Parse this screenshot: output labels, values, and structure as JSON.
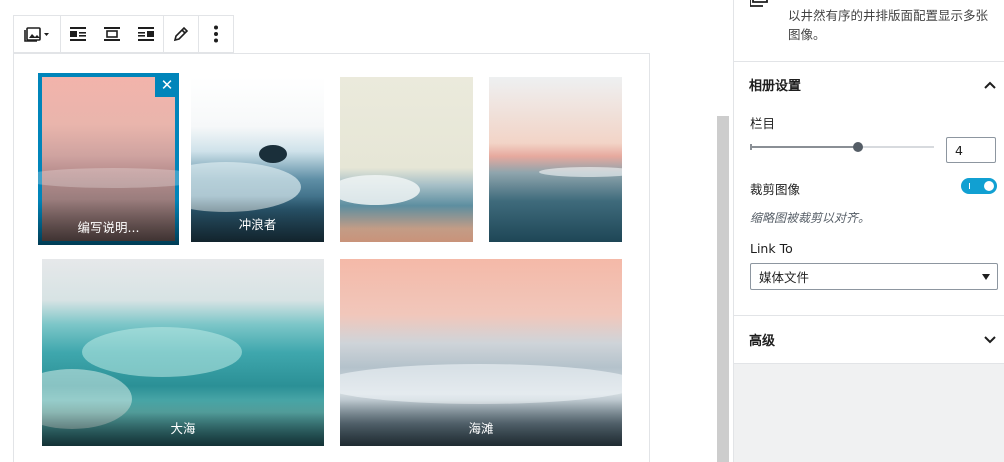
{
  "toolbar": {
    "buttons": [
      {
        "icon": "gallery-icon"
      },
      {
        "icon": "align-left-icon"
      },
      {
        "icon": "align-center-icon"
      },
      {
        "icon": "align-right-icon"
      },
      {
        "icon": "edit-pencil-icon"
      },
      {
        "icon": "more-vertical-icon"
      }
    ]
  },
  "gallery": {
    "images": [
      {
        "caption": "编写说明...",
        "selected": true
      },
      {
        "caption": "冲浪者",
        "selected": false
      },
      {
        "caption": "",
        "selected": false
      },
      {
        "caption": "",
        "selected": false
      },
      {
        "caption": "大海",
        "selected": false
      },
      {
        "caption": "海滩",
        "selected": false
      }
    ],
    "remove_symbol": "✕"
  },
  "sidebar": {
    "description": "以井然有序的井排版面配置显示多张图像。",
    "gallery_settings": {
      "title": "相册设置",
      "columns_label": "栏目",
      "columns_value": "4",
      "columns_fraction": 0.6,
      "crop_label": "裁剪图像",
      "crop_enabled": true,
      "crop_help": "缩略图被裁剪以对齐。",
      "link_to_label": "Link To",
      "link_to_value": "媒体文件"
    },
    "advanced": {
      "title": "高级"
    }
  },
  "colors": {
    "accent": "#0085ba",
    "toggle_on": "#11a0d2"
  }
}
